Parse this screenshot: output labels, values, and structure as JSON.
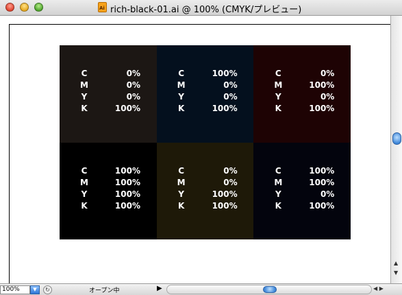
{
  "window": {
    "title": "rich-black-01.ai @ 100% (CMYK/プレビュー)",
    "file_icon_label": "Ai"
  },
  "swatches": [
    {
      "color": "#1c1714",
      "values": [
        {
          "k": "C",
          "v": "0%"
        },
        {
          "k": "M",
          "v": "0%"
        },
        {
          "k": "Y",
          "v": "0%"
        },
        {
          "k": "K",
          "v": "100%"
        }
      ]
    },
    {
      "color": "#04101e",
      "values": [
        {
          "k": "C",
          "v": "100%"
        },
        {
          "k": "M",
          "v": "0%"
        },
        {
          "k": "Y",
          "v": "0%"
        },
        {
          "k": "K",
          "v": "100%"
        }
      ]
    },
    {
      "color": "#1e0304",
      "values": [
        {
          "k": "C",
          "v": "0%"
        },
        {
          "k": "M",
          "v": "100%"
        },
        {
          "k": "Y",
          "v": "0%"
        },
        {
          "k": "K",
          "v": "100%"
        }
      ]
    },
    {
      "color": "#000000",
      "values": [
        {
          "k": "C",
          "v": "100%"
        },
        {
          "k": "M",
          "v": "100%"
        },
        {
          "k": "Y",
          "v": "100%"
        },
        {
          "k": "K",
          "v": "100%"
        }
      ]
    },
    {
      "color": "#1e1908",
      "values": [
        {
          "k": "C",
          "v": "0%"
        },
        {
          "k": "M",
          "v": "0%"
        },
        {
          "k": "Y",
          "v": "100%"
        },
        {
          "k": "K",
          "v": "100%"
        }
      ]
    },
    {
      "color": "#03040d",
      "values": [
        {
          "k": "C",
          "v": "100%"
        },
        {
          "k": "M",
          "v": "100%"
        },
        {
          "k": "Y",
          "v": "0%"
        },
        {
          "k": "K",
          "v": "100%"
        }
      ]
    }
  ],
  "statusbar": {
    "zoom": "100%",
    "status": "オープン中"
  }
}
